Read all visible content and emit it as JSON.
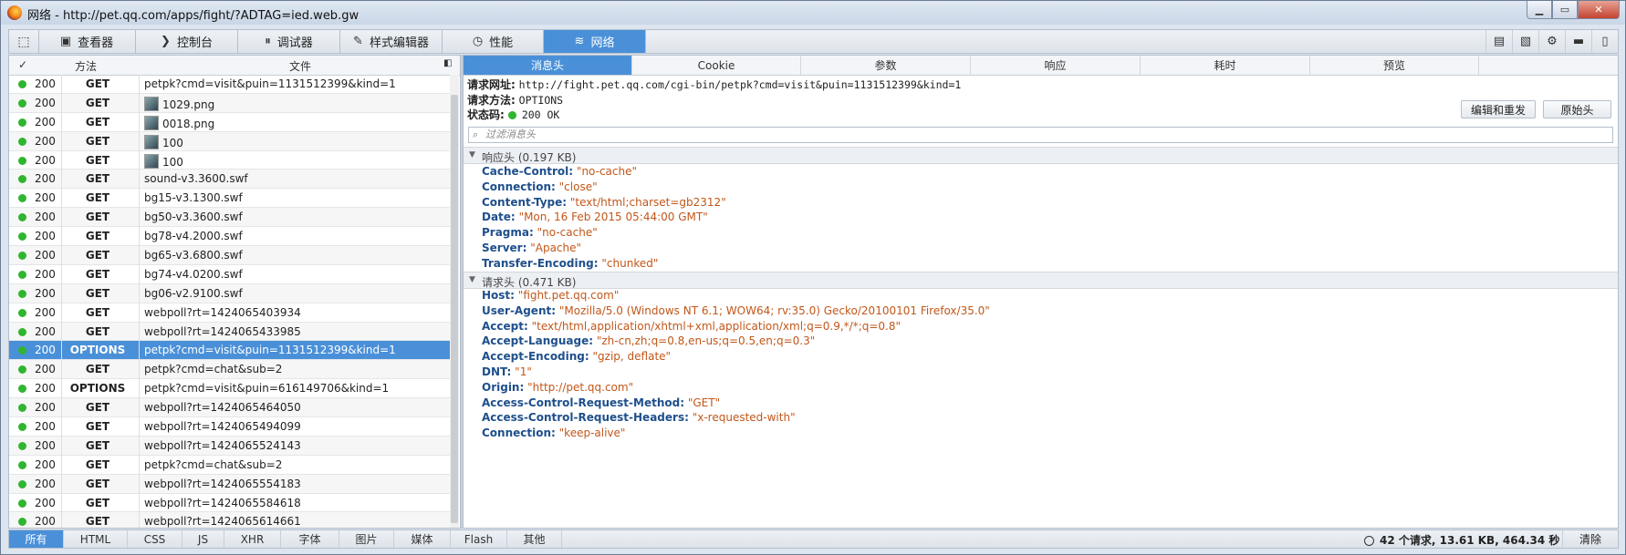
{
  "window": {
    "title": "网络 - http://pet.qq.com/apps/fight/?ADTAG=ied.web.gw"
  },
  "toolbar": {
    "tabs": [
      {
        "label": "查看器",
        "icon": "inspector-icon"
      },
      {
        "label": "控制台",
        "icon": "console-icon"
      },
      {
        "label": "调试器",
        "icon": "debugger-icon"
      },
      {
        "label": "样式编辑器",
        "icon": "style-editor-icon"
      },
      {
        "label": "性能",
        "icon": "performance-icon"
      },
      {
        "label": "网络",
        "icon": "network-icon",
        "active": true
      }
    ]
  },
  "request_list": {
    "headers": {
      "check": "✓",
      "method": "方法",
      "file": "文件"
    },
    "rows": [
      {
        "status": "200",
        "method": "GET",
        "file": "petpk?cmd=visit&puin=1131512399&kind=1"
      },
      {
        "status": "200",
        "method": "GET",
        "file": "1029.png",
        "thumb": true
      },
      {
        "status": "200",
        "method": "GET",
        "file": "0018.png",
        "thumb": true
      },
      {
        "status": "200",
        "method": "GET",
        "file": "100",
        "thumb": true
      },
      {
        "status": "200",
        "method": "GET",
        "file": "100",
        "thumb": true
      },
      {
        "status": "200",
        "method": "GET",
        "file": "sound-v3.3600.swf"
      },
      {
        "status": "200",
        "method": "GET",
        "file": "bg15-v3.1300.swf"
      },
      {
        "status": "200",
        "method": "GET",
        "file": "bg50-v3.3600.swf"
      },
      {
        "status": "200",
        "method": "GET",
        "file": "bg78-v4.2000.swf"
      },
      {
        "status": "200",
        "method": "GET",
        "file": "bg65-v3.6800.swf"
      },
      {
        "status": "200",
        "method": "GET",
        "file": "bg74-v4.0200.swf"
      },
      {
        "status": "200",
        "method": "GET",
        "file": "bg06-v2.9100.swf"
      },
      {
        "status": "200",
        "method": "GET",
        "file": "webpoll?rt=1424065403934"
      },
      {
        "status": "200",
        "method": "GET",
        "file": "webpoll?rt=1424065433985"
      },
      {
        "status": "200",
        "method": "OPTIONS",
        "file": "petpk?cmd=visit&puin=1131512399&kind=1",
        "selected": true
      },
      {
        "status": "200",
        "method": "GET",
        "file": "petpk?cmd=chat&sub=2"
      },
      {
        "status": "200",
        "method": "OPTIONS",
        "file": "petpk?cmd=visit&puin=616149706&kind=1"
      },
      {
        "status": "200",
        "method": "GET",
        "file": "webpoll?rt=1424065464050"
      },
      {
        "status": "200",
        "method": "GET",
        "file": "webpoll?rt=1424065494099"
      },
      {
        "status": "200",
        "method": "GET",
        "file": "webpoll?rt=1424065524143"
      },
      {
        "status": "200",
        "method": "GET",
        "file": "petpk?cmd=chat&sub=2"
      },
      {
        "status": "200",
        "method": "GET",
        "file": "webpoll?rt=1424065554183"
      },
      {
        "status": "200",
        "method": "GET",
        "file": "webpoll?rt=1424065584618"
      },
      {
        "status": "200",
        "method": "GET",
        "file": "webpoll?rt=1424065614661"
      }
    ]
  },
  "details": {
    "tabs": [
      "消息头",
      "Cookie",
      "参数",
      "响应",
      "耗时",
      "预览"
    ],
    "request_url_label": "请求网址:",
    "request_url": "http://fight.pet.qq.com/cgi-bin/petpk?cmd=visit&puin=1131512399&kind=1",
    "request_method_label": "请求方法:",
    "request_method": "OPTIONS",
    "status_code_label": "状态码:",
    "status_code": "200 OK",
    "edit_resend": "编辑和重发",
    "raw_headers": "原始头",
    "filter_placeholder": "过滤消息头",
    "response_section": "响应头 (0.197 KB)",
    "response_headers": [
      {
        "k": "Cache-Control:",
        "v": "\"no-cache\""
      },
      {
        "k": "Connection:",
        "v": "\"close\""
      },
      {
        "k": "Content-Type:",
        "v": "\"text/html;charset=gb2312\""
      },
      {
        "k": "Date:",
        "v": "\"Mon, 16 Feb 2015 05:44:00 GMT\""
      },
      {
        "k": "Pragma:",
        "v": "\"no-cache\""
      },
      {
        "k": "Server:",
        "v": "\"Apache\""
      },
      {
        "k": "Transfer-Encoding:",
        "v": "\"chunked\""
      }
    ],
    "request_section": "请求头 (0.471 KB)",
    "request_headers": [
      {
        "k": "Host:",
        "v": "\"fight.pet.qq.com\""
      },
      {
        "k": "User-Agent:",
        "v": "\"Mozilla/5.0 (Windows NT 6.1; WOW64; rv:35.0) Gecko/20100101 Firefox/35.0\""
      },
      {
        "k": "Accept:",
        "v": "\"text/html,application/xhtml+xml,application/xml;q=0.9,*/*;q=0.8\""
      },
      {
        "k": "Accept-Language:",
        "v": "\"zh-cn,zh;q=0.8,en-us;q=0.5,en;q=0.3\""
      },
      {
        "k": "Accept-Encoding:",
        "v": "\"gzip, deflate\""
      },
      {
        "k": "DNT:",
        "v": "\"1\""
      },
      {
        "k": "Origin:",
        "v": "\"http://pet.qq.com\""
      },
      {
        "k": "Access-Control-Request-Method:",
        "v": "\"GET\""
      },
      {
        "k": "Access-Control-Request-Headers:",
        "v": "\"x-requested-with\""
      },
      {
        "k": "Connection:",
        "v": "\"keep-alive\""
      }
    ]
  },
  "statusbar": {
    "filters": [
      "所有",
      "HTML",
      "CSS",
      "JS",
      "XHR",
      "字体",
      "图片",
      "媒体",
      "Flash",
      "其他"
    ],
    "summary": "42 个请求, 13.61 KB, 464.34 秒",
    "clear": "清除"
  },
  "colors": {
    "accent": "#4a90d9",
    "ok": "#2fb52f",
    "header_key": "#1e4f8c",
    "header_value": "#c2571a"
  }
}
